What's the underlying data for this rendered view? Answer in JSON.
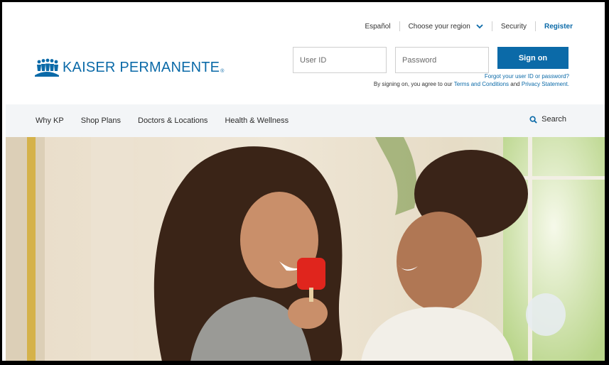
{
  "utility_bar": {
    "espanol": "Español",
    "region": "Choose your region",
    "security": "Security",
    "register": "Register"
  },
  "brand": {
    "name": "KAISER PERMANENTE",
    "registered": "®"
  },
  "login": {
    "user_placeholder": "User ID",
    "password_placeholder": "Password",
    "sign_on": "Sign on",
    "forgot_prefix": "Forgot your user ID or ",
    "forgot_password": "password?",
    "agree_prefix": "By signing on, you agree to our ",
    "terms": "Terms and Conditions",
    "and": " and ",
    "privacy": "Privacy Statement."
  },
  "nav": {
    "items": [
      "Why KP",
      "Shop Plans",
      "Doctors & Locations",
      "Health & Wellness"
    ],
    "search": "Search"
  },
  "colors": {
    "brand_blue": "#0b6aa8",
    "nav_bg": "#f3f5f7"
  },
  "icons": {
    "logo": "kp-people-logo-icon",
    "region": "chevron-down-icon",
    "search": "search-icon"
  }
}
